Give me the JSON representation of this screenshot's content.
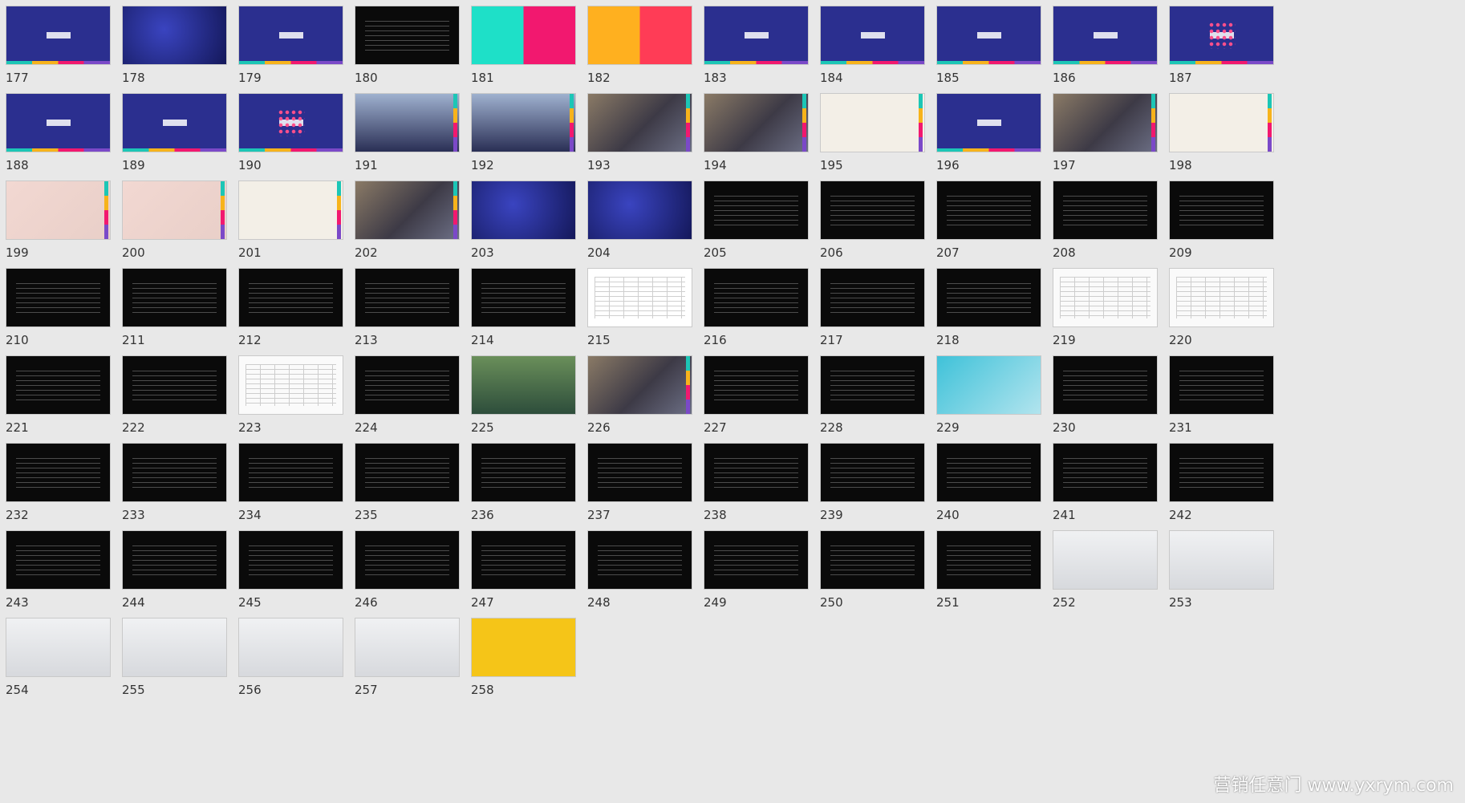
{
  "slides": [
    {
      "n": "177",
      "k": "blue"
    },
    {
      "n": "178",
      "k": "deep"
    },
    {
      "n": "179",
      "k": "blue"
    },
    {
      "n": "180",
      "k": "black"
    },
    {
      "n": "181",
      "k": "split"
    },
    {
      "n": "182",
      "k": "split2"
    },
    {
      "n": "183",
      "k": "blue"
    },
    {
      "n": "184",
      "k": "blue"
    },
    {
      "n": "185",
      "k": "blue"
    },
    {
      "n": "186",
      "k": "blue"
    },
    {
      "n": "187",
      "k": "blueS"
    },
    {
      "n": "188",
      "k": "blue"
    },
    {
      "n": "189",
      "k": "blue"
    },
    {
      "n": "190",
      "k": "blueS"
    },
    {
      "n": "191",
      "k": "bldg"
    },
    {
      "n": "192",
      "k": "bldg"
    },
    {
      "n": "193",
      "k": "photo"
    },
    {
      "n": "194",
      "k": "photo"
    },
    {
      "n": "195",
      "k": "cream"
    },
    {
      "n": "196",
      "k": "blue"
    },
    {
      "n": "197",
      "k": "photo"
    },
    {
      "n": "198",
      "k": "cream"
    },
    {
      "n": "199",
      "k": "pink"
    },
    {
      "n": "200",
      "k": "pink"
    },
    {
      "n": "201",
      "k": "cream"
    },
    {
      "n": "202",
      "k": "photo"
    },
    {
      "n": "203",
      "k": "deep"
    },
    {
      "n": "204",
      "k": "deep"
    },
    {
      "n": "205",
      "k": "black"
    },
    {
      "n": "206",
      "k": "black"
    },
    {
      "n": "207",
      "k": "black"
    },
    {
      "n": "208",
      "k": "black"
    },
    {
      "n": "209",
      "k": "black"
    },
    {
      "n": "210",
      "k": "black"
    },
    {
      "n": "211",
      "k": "black"
    },
    {
      "n": "212",
      "k": "black"
    },
    {
      "n": "213",
      "k": "black"
    },
    {
      "n": "214",
      "k": "black"
    },
    {
      "n": "215",
      "k": "table"
    },
    {
      "n": "216",
      "k": "black"
    },
    {
      "n": "217",
      "k": "black"
    },
    {
      "n": "218",
      "k": "black"
    },
    {
      "n": "219",
      "k": "white"
    },
    {
      "n": "220",
      "k": "white"
    },
    {
      "n": "221",
      "k": "black"
    },
    {
      "n": "222",
      "k": "black"
    },
    {
      "n": "223",
      "k": "white"
    },
    {
      "n": "224",
      "k": "black"
    },
    {
      "n": "225",
      "k": "green"
    },
    {
      "n": "226",
      "k": "photo"
    },
    {
      "n": "227",
      "k": "black"
    },
    {
      "n": "228",
      "k": "black"
    },
    {
      "n": "229",
      "k": "map"
    },
    {
      "n": "230",
      "k": "black"
    },
    {
      "n": "231",
      "k": "black"
    },
    {
      "n": "232",
      "k": "black"
    },
    {
      "n": "233",
      "k": "black"
    },
    {
      "n": "234",
      "k": "black"
    },
    {
      "n": "235",
      "k": "black"
    },
    {
      "n": "236",
      "k": "black"
    },
    {
      "n": "237",
      "k": "black"
    },
    {
      "n": "238",
      "k": "black"
    },
    {
      "n": "239",
      "k": "black"
    },
    {
      "n": "240",
      "k": "black"
    },
    {
      "n": "241",
      "k": "black"
    },
    {
      "n": "242",
      "k": "black"
    },
    {
      "n": "243",
      "k": "black"
    },
    {
      "n": "244",
      "k": "black"
    },
    {
      "n": "245",
      "k": "black"
    },
    {
      "n": "246",
      "k": "black"
    },
    {
      "n": "247",
      "k": "black"
    },
    {
      "n": "248",
      "k": "black"
    },
    {
      "n": "249",
      "k": "black"
    },
    {
      "n": "250",
      "k": "black"
    },
    {
      "n": "251",
      "k": "black"
    },
    {
      "n": "252",
      "k": "profile"
    },
    {
      "n": "253",
      "k": "profile"
    },
    {
      "n": "254",
      "k": "profile"
    },
    {
      "n": "255",
      "k": "profile"
    },
    {
      "n": "256",
      "k": "profile"
    },
    {
      "n": "257",
      "k": "profile"
    },
    {
      "n": "258",
      "k": "yellow"
    }
  ],
  "watermark": "营销任意门 www.yxrym.com"
}
